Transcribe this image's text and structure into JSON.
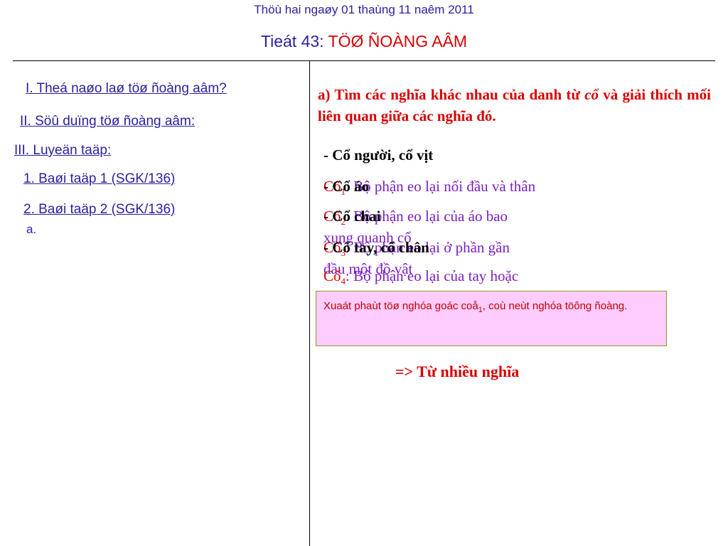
{
  "header": {
    "date": "Thöù hai ngaøy 01 thaùng 11 naêm 2011",
    "lesson_label": "Tieát 43: ",
    "lesson_name": "TÖØ ÑOÀNG AÂM"
  },
  "left": {
    "item1": "I. Theá naøo laø töø ñoàng aâm?",
    "item2": "II. Söû duïng töø ñoàng aâm:",
    "item3": "III. Luyeän taäp:",
    "ex1": "1. Baøi taäp 1 (SGK/136)",
    "ex2": "2. Baøi taäp 2 (SGK/136)",
    "sub": "a."
  },
  "right": {
    "task_prefix": "a) Tìm các nghĩa khác nhau của danh từ ",
    "task_word": "cổ",
    "task_suffix": " và giải thích mối liên quan giữa các nghĩa đó.",
    "line1": "- Cổ người, cổ vịt",
    "def1_red": "Cổ",
    "def1_sub": "1",
    "def1_purple": ": Bộ phận eo lại nối đầu và thân",
    "line2": "- Cổ áo",
    "def2_red": "Cổ",
    "def2_sub": "2",
    "def2_purple": ": Bộ phận eo lại của áo bao",
    "def2_cont": "xung quanh cổ",
    "line3": "- Cổ chai",
    "def3_red": "Cổ",
    "def3_sub": "3",
    "def3_purple": ": Bộ phận eo lại ở phần gần",
    "def3_cont": "đầu một đồ vật",
    "line4": "- Cổ tay, cổ chân",
    "def4_red": "Cổ",
    "def4_sub": "4",
    "def4_purple": ": Bộ phận eo lại của tay hoặc",
    "note_main": "Xuaát phaùt töø nghóa goác coå",
    "note_sub": "1",
    "note_rest": ", coù neùt nghóa töông ñoàng.",
    "result": "=> Từ nhiều nghĩa"
  },
  "colors": {
    "blue": "#2a1fa0",
    "red": "#d80000",
    "purple": "#7a1fc4",
    "note_bg": "#ffccff"
  }
}
